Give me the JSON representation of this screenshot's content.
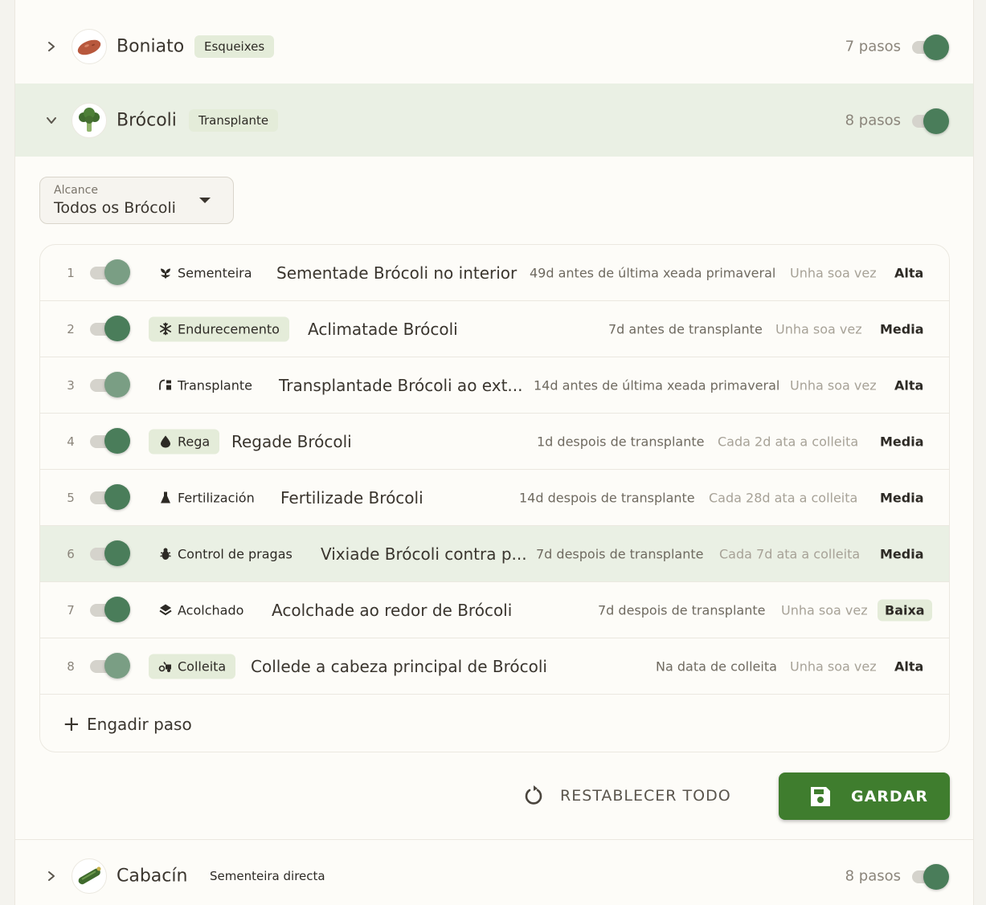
{
  "crops": [
    {
      "name": "Boniato",
      "method": "Esqueixes",
      "steps": "7 pasos",
      "icon": "sweet-potato-icon"
    },
    {
      "name": "Brócoli",
      "method": "Transplante",
      "steps": "8 pasos",
      "icon": "broccoli-icon"
    },
    {
      "name": "Cabacín",
      "method": "Sementeira directa",
      "steps": "8 pasos",
      "icon": "zucchini-icon"
    }
  ],
  "scope": {
    "label": "Alcance",
    "value": "Todos os Brócoli"
  },
  "steps": [
    {
      "num": "1",
      "category": "Sementeira",
      "title": "Sementade Brócoli no interior",
      "timing": "49d antes de última xeada primaveral",
      "frequency": "Unha soa vez",
      "priority": "Alta",
      "icon": "seedling-icon"
    },
    {
      "num": "2",
      "category": "Endurecemento",
      "title": "Aclimatade Brócoli",
      "timing": "7d antes de transplante",
      "frequency": "Unha soa vez",
      "priority": "Media",
      "icon": "snowflake-icon"
    },
    {
      "num": "3",
      "category": "Transplante",
      "title": "Transplantade Brócoli ao ext...",
      "timing": "14d antes de última xeada primaveral",
      "frequency": "Unha soa vez",
      "priority": "Alta",
      "icon": "transplant-icon"
    },
    {
      "num": "4",
      "category": "Rega",
      "title": "Regade Brócoli",
      "timing": "1d despois de transplante",
      "frequency": "Cada 2d ata a colleita",
      "priority": "Media",
      "icon": "water-drop-icon"
    },
    {
      "num": "5",
      "category": "Fertilización",
      "title": "Fertilizade Brócoli",
      "timing": "14d despois de transplante",
      "frequency": "Cada 28d ata a colleita",
      "priority": "Media",
      "icon": "flask-icon"
    },
    {
      "num": "6",
      "category": "Control de pragas",
      "title": "Vixiade Brócoli contra p...",
      "timing": "7d despois de transplante",
      "frequency": "Cada 7d ata a colleita",
      "priority": "Media",
      "icon": "bug-icon"
    },
    {
      "num": "7",
      "category": "Acolchado",
      "title": "Acolchade ao redor de Brócoli",
      "timing": "7d despois de transplante",
      "frequency": "Unha soa vez",
      "priority": "Baixa",
      "icon": "layers-icon"
    },
    {
      "num": "8",
      "category": "Colleita",
      "title": "Collede a cabeza principal de Brócoli",
      "timing": "Na data de colleita",
      "frequency": "Unha soa vez",
      "priority": "Alta",
      "icon": "harvest-icon"
    }
  ],
  "add_step": {
    "plus": "+",
    "label": "Engadir paso"
  },
  "actions": {
    "reset": "RESTABLECER TODO",
    "save": "GARDAR"
  },
  "colors": {
    "accent": "#3f7d2e",
    "toggle_on": "#4a7d5a",
    "badge_bg": "#e4ecd9",
    "expanded_bg": "#eaf0e4"
  }
}
